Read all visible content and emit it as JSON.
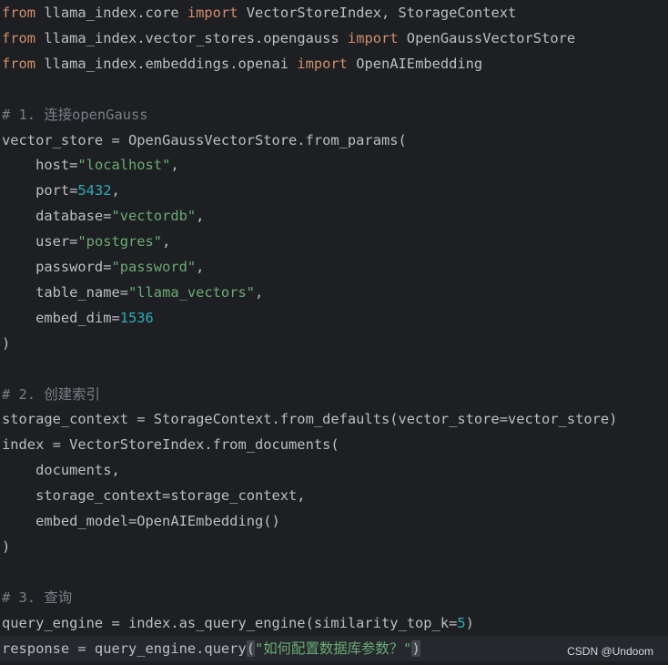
{
  "code_lines": [
    [
      {
        "t": "from",
        "c": "kw"
      },
      {
        "t": " llama_index.core ",
        "c": "id"
      },
      {
        "t": "import",
        "c": "kw"
      },
      {
        "t": " VectorStoreIndex, StorageContext",
        "c": "id"
      }
    ],
    [
      {
        "t": "from",
        "c": "kw"
      },
      {
        "t": " llama_index.vector_stores.opengauss ",
        "c": "id"
      },
      {
        "t": "import",
        "c": "kw"
      },
      {
        "t": " OpenGaussVectorStore",
        "c": "id"
      }
    ],
    [
      {
        "t": "from",
        "c": "kw"
      },
      {
        "t": " llama_index.embeddings.openai ",
        "c": "id"
      },
      {
        "t": "import",
        "c": "kw"
      },
      {
        "t": " OpenAIEmbedding",
        "c": "id"
      }
    ],
    [],
    [
      {
        "t": "# 1. 连接openGauss",
        "c": "cm"
      }
    ],
    [
      {
        "t": "vector_store = OpenGaussVectorStore.from_params(",
        "c": "id"
      }
    ],
    [
      {
        "t": "    host=",
        "c": "id"
      },
      {
        "t": "\"localhost\"",
        "c": "str"
      },
      {
        "t": ",",
        "c": "id"
      }
    ],
    [
      {
        "t": "    port=",
        "c": "id"
      },
      {
        "t": "5432",
        "c": "num"
      },
      {
        "t": ",",
        "c": "id"
      }
    ],
    [
      {
        "t": "    database=",
        "c": "id"
      },
      {
        "t": "\"vectordb\"",
        "c": "str"
      },
      {
        "t": ",",
        "c": "id"
      }
    ],
    [
      {
        "t": "    user=",
        "c": "id"
      },
      {
        "t": "\"postgres\"",
        "c": "str"
      },
      {
        "t": ",",
        "c": "id"
      }
    ],
    [
      {
        "t": "    password=",
        "c": "id"
      },
      {
        "t": "\"password\"",
        "c": "str"
      },
      {
        "t": ",",
        "c": "id"
      }
    ],
    [
      {
        "t": "    table_name=",
        "c": "id"
      },
      {
        "t": "\"llama_vectors\"",
        "c": "str"
      },
      {
        "t": ",",
        "c": "id"
      }
    ],
    [
      {
        "t": "    embed_dim=",
        "c": "id"
      },
      {
        "t": "1536",
        "c": "num"
      }
    ],
    [
      {
        "t": ")",
        "c": "id"
      }
    ],
    [],
    [
      {
        "t": "# 2. 创建索引",
        "c": "cm"
      }
    ],
    [
      {
        "t": "storage_context = StorageContext.from_defaults(vector_store=vector_store)",
        "c": "id"
      }
    ],
    [
      {
        "t": "index = VectorStoreIndex.from_documents(",
        "c": "id"
      }
    ],
    [
      {
        "t": "    documents,",
        "c": "id"
      }
    ],
    [
      {
        "t": "    storage_context=storage_context,",
        "c": "id"
      }
    ],
    [
      {
        "t": "    embed_model=OpenAIEmbedding()",
        "c": "id"
      }
    ],
    [
      {
        "t": ")",
        "c": "id"
      }
    ],
    [],
    [
      {
        "t": "# 3. 查询",
        "c": "cm"
      }
    ],
    [
      {
        "t": "query_engine = index.as_query_engine(similarity_top_k=",
        "c": "id"
      },
      {
        "t": "5",
        "c": "num"
      },
      {
        "t": ")",
        "c": "id"
      }
    ],
    [
      {
        "t": "response = query_engine.query",
        "c": "id"
      },
      {
        "t": "(",
        "c": "paren-match"
      },
      {
        "t": "\"如何配置数据库参数？\"",
        "c": "str"
      },
      {
        "t": ")",
        "c": "paren-match"
      }
    ]
  ],
  "current_line_index": 25,
  "watermark": "CSDN @Undoom",
  "colors": {
    "background": "#1e1f22",
    "keyword": "#cf8e6d",
    "comment": "#7a7e85",
    "string": "#6aab73",
    "number": "#2aacb8",
    "identifier": "#bcbec4"
  }
}
